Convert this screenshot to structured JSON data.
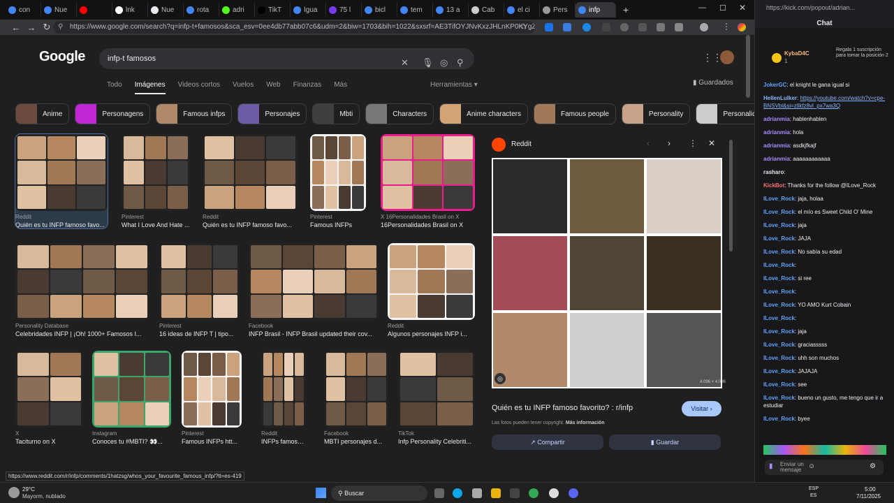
{
  "tabs": [
    "con",
    "Nue",
    "",
    "lnk",
    "Nue",
    "rota",
    "adri",
    "TikT",
    "Igua",
    "75 l",
    "bicl",
    "tem",
    "13 a",
    "Cab",
    "el ci",
    "Pers",
    "infp"
  ],
  "url": "https://www.google.com/search?q=infp-t+famosos&sca_esv=0ee4db77abb07c6&udm=2&biw=1703&bih=1022&sxsrf=AE3TifOYJNvKxzJHLnKP0KYgZPr4iyRq-Q...",
  "google": {
    "logo": "Google",
    "query": "infp-t famosos",
    "nav": [
      "Todo",
      "Imágenes",
      "Videos cortos",
      "Vuelos",
      "Web",
      "Finanzas",
      "Más"
    ],
    "tools": "Herramientas ▾",
    "saved": "Guardados",
    "chips": [
      "Anime",
      "Personagens",
      "Famous infps",
      "Personajes",
      "Mbti",
      "Characters",
      "Anime characters",
      "Famous people",
      "Personality",
      "Personalidade",
      "Per"
    ]
  },
  "cards": [
    {
      "src": "Reddit",
      "title": "Quién es tu INFP famoso favo..."
    },
    {
      "src": "Pinterest",
      "title": "What I Love And Hate ..."
    },
    {
      "src": "Reddit",
      "title": "Quién es tu INFP famoso favo..."
    },
    {
      "src": "Pinterest",
      "title": "Famous INFPs"
    },
    {
      "src": "X 16Personalidades Brasil on X",
      "title": "16Personalidades Brasil on X"
    },
    {
      "src": "Personality Database",
      "title": "Celebridades INFP | ¡Oh! 1000+ Famosos I..."
    },
    {
      "src": "Pinterest",
      "title": "16 ideas de INFP T | tipo..."
    },
    {
      "src": "Facebook",
      "title": "INFP Brasil - INFP Brasil updated their cov..."
    },
    {
      "src": "Reddit",
      "title": "Algunos personajes INFP i..."
    },
    {
      "src": "X",
      "title": "Taciturno on X"
    },
    {
      "src": "Instagram",
      "title": "Conoces tu #MBTI? 👀..."
    },
    {
      "src": "Pinterest",
      "title": "Famous INFPs htt..."
    },
    {
      "src": "Reddit",
      "title": "INFPs famosos. M..."
    },
    {
      "src": "Facebook",
      "title": "MBTI personajes d..."
    },
    {
      "src": "TikTok",
      "title": "Infp Personality Celebriti..."
    }
  ],
  "card_texts": {
    "infp_badge": "INFP",
    "infp_sub": "vida real & filmes",
    "famous_head": "Famous INFPs (& dreamers)",
    "chars_head": "INFP characters",
    "fb_head": "INFP",
    "attrib": "PDB App Personality Database",
    "infp_box": "INFP",
    "kirk": "INFP"
  },
  "panel": {
    "site": "Reddit",
    "title": "Quién es tu INFP famoso favorito? : r/infp",
    "visit": "Visitar ›",
    "notice": "Las fotos pueden tener copyright.",
    "more": "Más información",
    "share": "Compartir",
    "save": "Guardar",
    "dims": "4.096 × 4.096"
  },
  "status_url": "https://www.reddit.com/r/infp/comments/1hatzsg/whos_your_favourite_famous_infp/?tl=es-419",
  "chat": {
    "url": "https://kick.com/popout/adrian...",
    "title": "Chat",
    "pinned_user": "KybaD4C",
    "pinned_count": "1",
    "pinned_text": "Regala 1 suscripción para tomar la posición 2",
    "messages": [
      {
        "user": "JokerGC",
        "text": "el knight le gana igual si",
        "color": "#60a5fa"
      },
      {
        "user": "HellenLulker",
        "text": "https://youtube.com/watch?v=cpe-BNSVbl&si=zllkfz8vl_px7wa3Q",
        "color": "#8ab4f8"
      },
      {
        "user": "adrianmia",
        "text": "hablenhablen",
        "color": "#a78bfa"
      },
      {
        "user": "adrianmia",
        "text": "hola",
        "color": "#a78bfa"
      },
      {
        "user": "adrianmia",
        "text": "asdkjfkajf",
        "color": "#a78bfa"
      },
      {
        "user": "adrianmia",
        "text": "aaaaaaaaaaaa",
        "color": "#a78bfa"
      },
      {
        "user": "rasharo",
        "text": "",
        "color": "#e5e7eb"
      },
      {
        "user": "KickBot",
        "text": "Thanks for the follow @ILove_Rock",
        "color": "#f87171"
      },
      {
        "user": "ILove_Rock",
        "text": "jaja, holaa",
        "color": "#60a5fa"
      },
      {
        "user": "ILove_Rock",
        "text": "el mío es Sweet Child O' Mine",
        "color": "#60a5fa"
      },
      {
        "user": "ILove_Rock",
        "text": "jaja",
        "color": "#60a5fa"
      },
      {
        "user": "ILove_Rock",
        "text": "JAJA",
        "color": "#60a5fa"
      },
      {
        "user": "ILove_Rock",
        "text": "No sabía su edad",
        "color": "#60a5fa"
      },
      {
        "user": "ILove_Rock",
        "text": "",
        "color": "#60a5fa"
      },
      {
        "user": "ILove_Rock",
        "text": "si ree",
        "color": "#60a5fa"
      },
      {
        "user": "ILove_Rock",
        "text": "",
        "color": "#60a5fa"
      },
      {
        "user": "ILove_Rock",
        "text": "YO AMO Kurt Cobain",
        "color": "#60a5fa"
      },
      {
        "user": "ILove_Rock",
        "text": "",
        "color": "#60a5fa"
      },
      {
        "user": "ILove_Rock",
        "text": "jaja",
        "color": "#60a5fa"
      },
      {
        "user": "ILove_Rock",
        "text": "graciasssss",
        "color": "#60a5fa"
      },
      {
        "user": "ILove_Rock",
        "text": "uhh son muchos",
        "color": "#60a5fa"
      },
      {
        "user": "ILove_Rock",
        "text": "JAJAJA",
        "color": "#60a5fa"
      },
      {
        "user": "ILove_Rock",
        "text": "see",
        "color": "#60a5fa"
      },
      {
        "user": "ILove_Rock",
        "text": "bueno un gusto, me tengo que ir a estudiar",
        "color": "#60a5fa"
      },
      {
        "user": "ILove_Rock",
        "text": "byee",
        "color": "#60a5fa"
      }
    ],
    "input_placeholder": "Enviar un mensaje"
  },
  "taskbar": {
    "weather_temp": "29°C",
    "weather_desc": "Mayorm. nublado",
    "search": "Buscar",
    "lang1": "ESP",
    "lang2": "ES",
    "time": "5:00",
    "date": "7/11/2025"
  }
}
